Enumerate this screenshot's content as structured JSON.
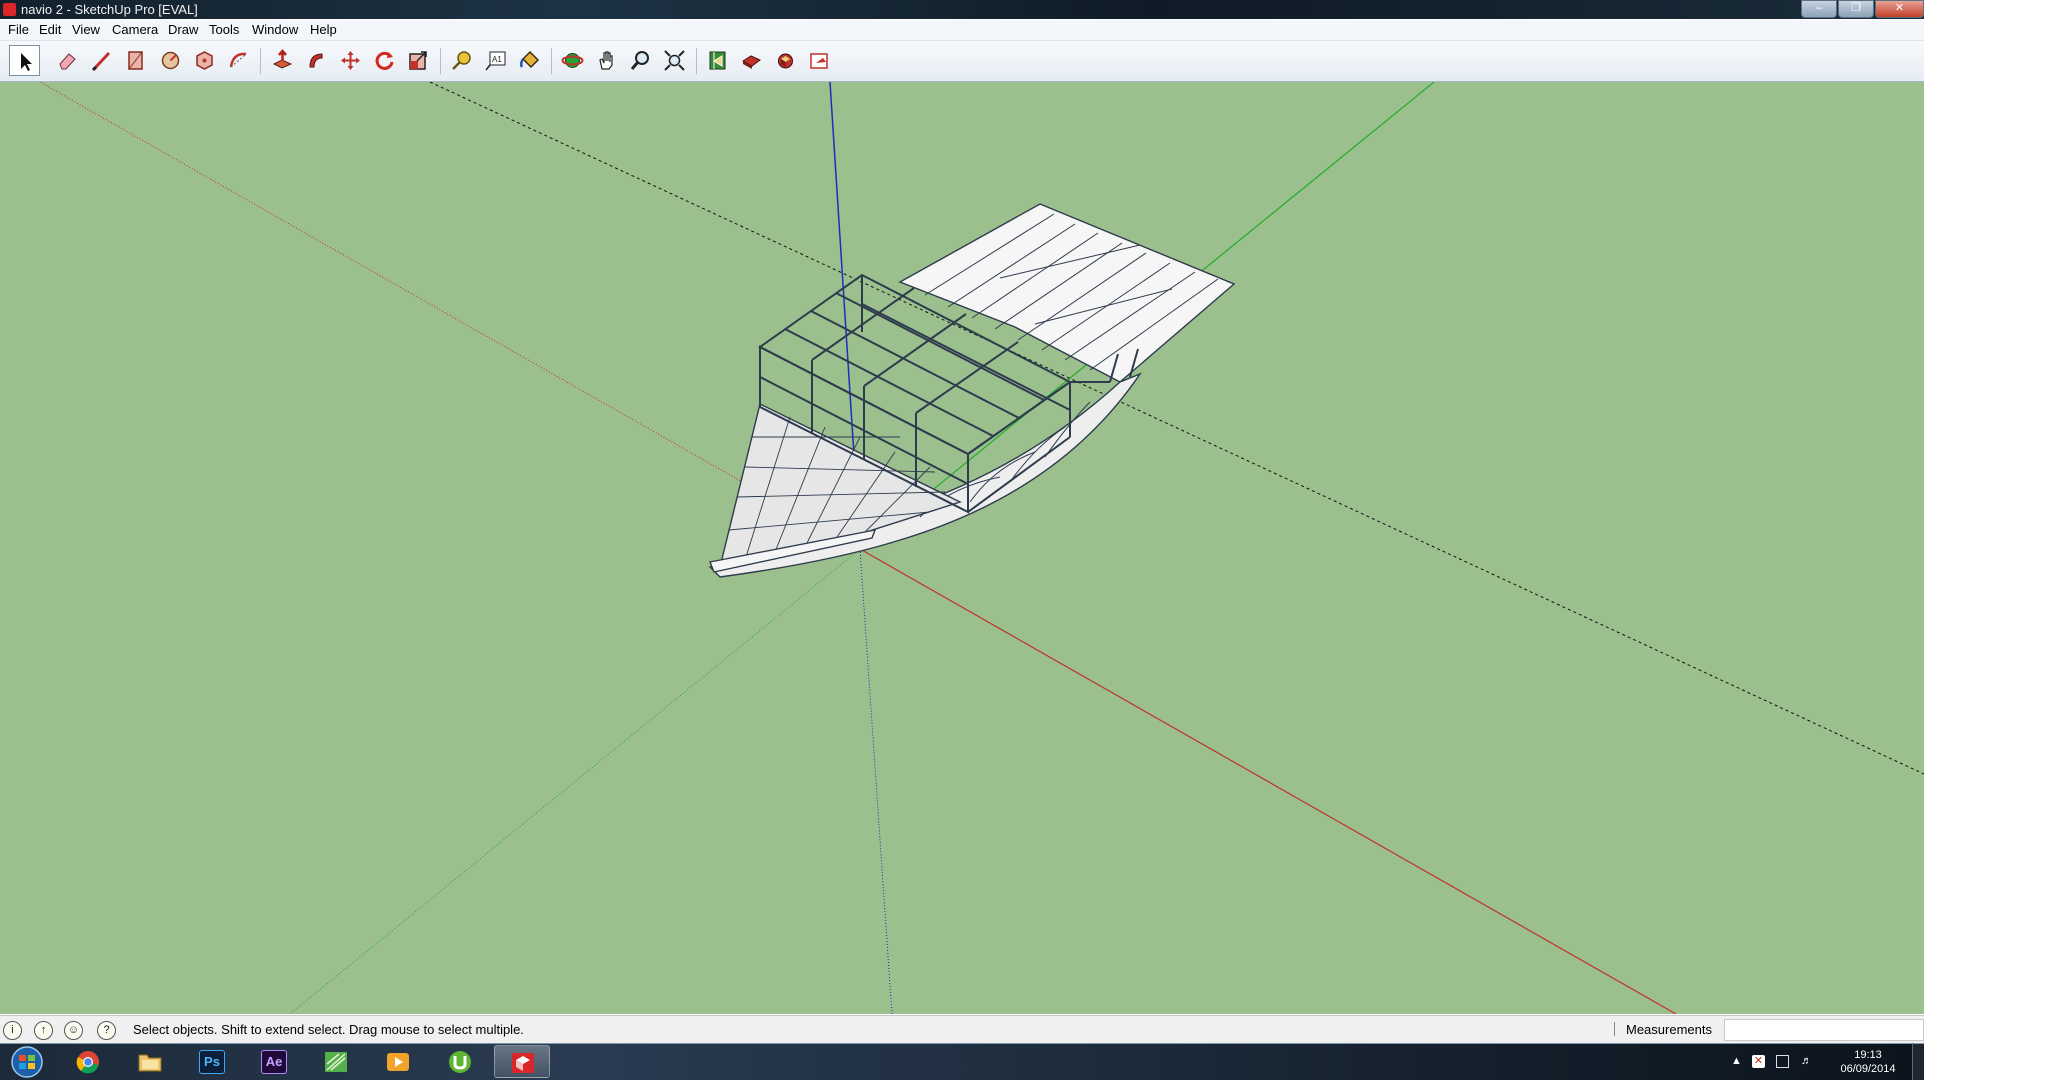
{
  "window": {
    "title": "navio 2 - SketchUp Pro [EVAL]",
    "controls": [
      "minimize-button",
      "restore-button",
      "close-button"
    ]
  },
  "menu": [
    "File",
    "Edit",
    "View",
    "Camera",
    "Draw",
    "Tools",
    "Window",
    "Help"
  ],
  "toolbar": {
    "tools": [
      "select-tool-icon",
      "eraser-tool-icon",
      "line-tool-icon",
      "rectangle-tool-icon",
      "circle-tool-icon",
      "polygon-tool-icon",
      "arc-tool-icon",
      "push-pull-tool-icon",
      "follow-me-tool-icon",
      "move-tool-icon",
      "rotate-tool-icon",
      "scale-tool-icon",
      "tape-measure-tool-icon",
      "text-tool-icon",
      "paint-bucket-tool-icon",
      "orbit-tool-icon",
      "pan-tool-icon",
      "zoom-tool-icon",
      "zoom-extents-tool-icon",
      "get-models-icon",
      "share-model-icon",
      "share-component-icon",
      "send-to-layout-icon"
    ],
    "active_tool": "select-tool-icon"
  },
  "colors": {
    "viewport_background": "#9cbf8e",
    "red_axis": "#c0322a",
    "green_axis": "#1fae2a",
    "blue_axis": "#1a2fbe",
    "model_edge": "#2e3b4d",
    "model_face": "#f3f3f3"
  },
  "statusbar": {
    "icons": [
      "geo-location-icon",
      "credits-icon",
      "sign-in-icon",
      "help-icon"
    ],
    "text": "Select objects. Shift to extend select. Drag mouse to select multiple.",
    "measurements_label": "Measurements",
    "measurements_value": ""
  },
  "taskbar": {
    "start": "windows-start-icon",
    "apps": [
      {
        "name": "chrome",
        "label": ""
      },
      {
        "name": "file-explorer",
        "label": ""
      },
      {
        "name": "photoshop",
        "label": "Ps"
      },
      {
        "name": "after-effects",
        "label": "Ae"
      },
      {
        "name": "sketchup-layout",
        "label": ""
      },
      {
        "name": "media-player",
        "label": ""
      },
      {
        "name": "utorrent",
        "label": ""
      },
      {
        "name": "sketchup",
        "label": ""
      }
    ],
    "tray_icons": [
      "show-hidden-icons-icon",
      "action-center-icon",
      "network-icon",
      "volume-icon"
    ],
    "time": "19:13",
    "date": "06/09/2014"
  }
}
